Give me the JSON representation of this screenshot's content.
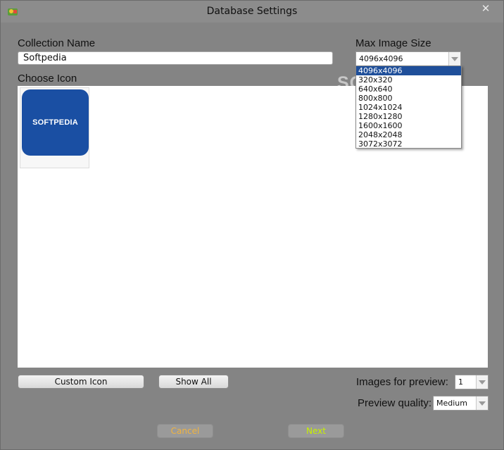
{
  "window": {
    "title": "Database Settings",
    "close_glyph": "✕"
  },
  "collection": {
    "label": "Collection Name",
    "value": "Softpedia"
  },
  "max_image_size": {
    "label": "Max Image Size",
    "selected": "4096x4096",
    "options": [
      "4096x4096",
      "320x320",
      "640x640",
      "800x800",
      "1024x1024",
      "1280x1280",
      "1600x1600",
      "2048x2048",
      "3072x3072"
    ]
  },
  "choose_icon": {
    "label": "Choose Icon",
    "icon_text": "SOFTPEDIA"
  },
  "watermark": "SOFTPEDIA",
  "buttons": {
    "custom_icon": "Custom Icon",
    "show_all": "Show All",
    "cancel": "Cancel",
    "next": "Next"
  },
  "preview": {
    "images_label": "Images for preview:",
    "images_value": "1",
    "quality_label": "Preview quality:",
    "quality_value": "Medium"
  },
  "colors": {
    "background": "#848484",
    "selection": "#1f4f9a",
    "logo_blue": "#1a4fa3"
  },
  "icons": {
    "app": "app-icon",
    "close": "close-icon",
    "dropdown": "chevron-down-icon"
  }
}
